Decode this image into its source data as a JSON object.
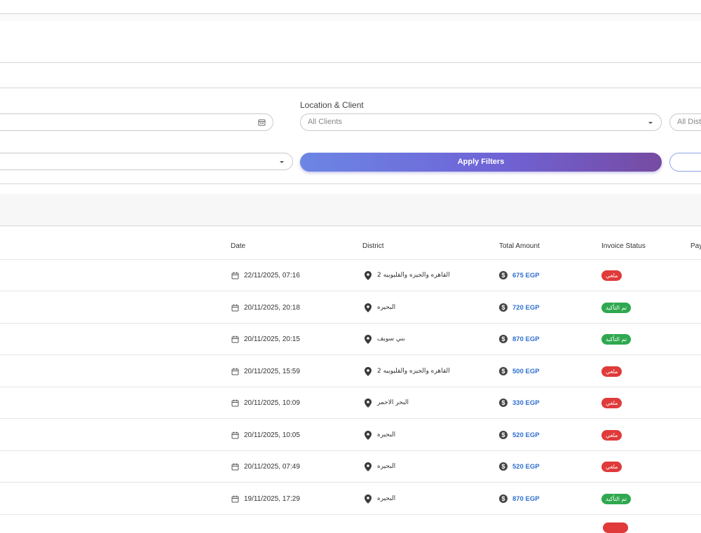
{
  "filters": {
    "location_label": "Location & Client",
    "client_placeholder": "All Clients",
    "district_placeholder": "All Distri",
    "apply_label": "Apply Filters"
  },
  "table": {
    "headers": {
      "date": "Date",
      "district": "District",
      "total_amount": "Total Amount",
      "invoice_status": "Invoice Status",
      "payment": "Pay"
    },
    "rows": [
      {
        "date": "22/11/2025, 07:16",
        "district": "القاهره والجيزه والقليوبيه 2",
        "amount": "675 EGP",
        "status": "ملغي",
        "status_color": "#e03a3a"
      },
      {
        "date": "20/11/2025, 20:18",
        "district": "البحيره",
        "amount": "720 EGP",
        "status": "تم التأكيد",
        "status_color": "#2fa84f"
      },
      {
        "date": "20/11/2025, 20:15",
        "district": "بني سويف",
        "amount": "870 EGP",
        "status": "تم التأكيد",
        "status_color": "#2fa84f"
      },
      {
        "date": "20/11/2025, 15:59",
        "district": "القاهره والجيزه والقليوبيه 2",
        "amount": "500 EGP",
        "status": "ملغي",
        "status_color": "#e03a3a"
      },
      {
        "date": "20/11/2025, 10:09",
        "district": "البحر الاحمر",
        "amount": "330 EGP",
        "status": "ملغي",
        "status_color": "#e03a3a"
      },
      {
        "date": "20/11/2025, 10:05",
        "district": "البحيره",
        "amount": "520 EGP",
        "status": "ملغي",
        "status_color": "#e03a3a"
      },
      {
        "date": "20/11/2025, 07:49",
        "district": "البحيره",
        "amount": "520 EGP",
        "status": "ملغي",
        "status_color": "#e03a3a"
      },
      {
        "date": "19/11/2025, 17:29",
        "district": "البحيره",
        "amount": "870 EGP",
        "status": "تم التأكيد",
        "status_color": "#2fa84f"
      }
    ]
  },
  "icons": {
    "date": "calendar-icon",
    "district": "location-pin-icon",
    "amount": "dollar-coin-icon",
    "dropdown": "chevron-down-icon",
    "date_picker": "calendar-icon"
  }
}
